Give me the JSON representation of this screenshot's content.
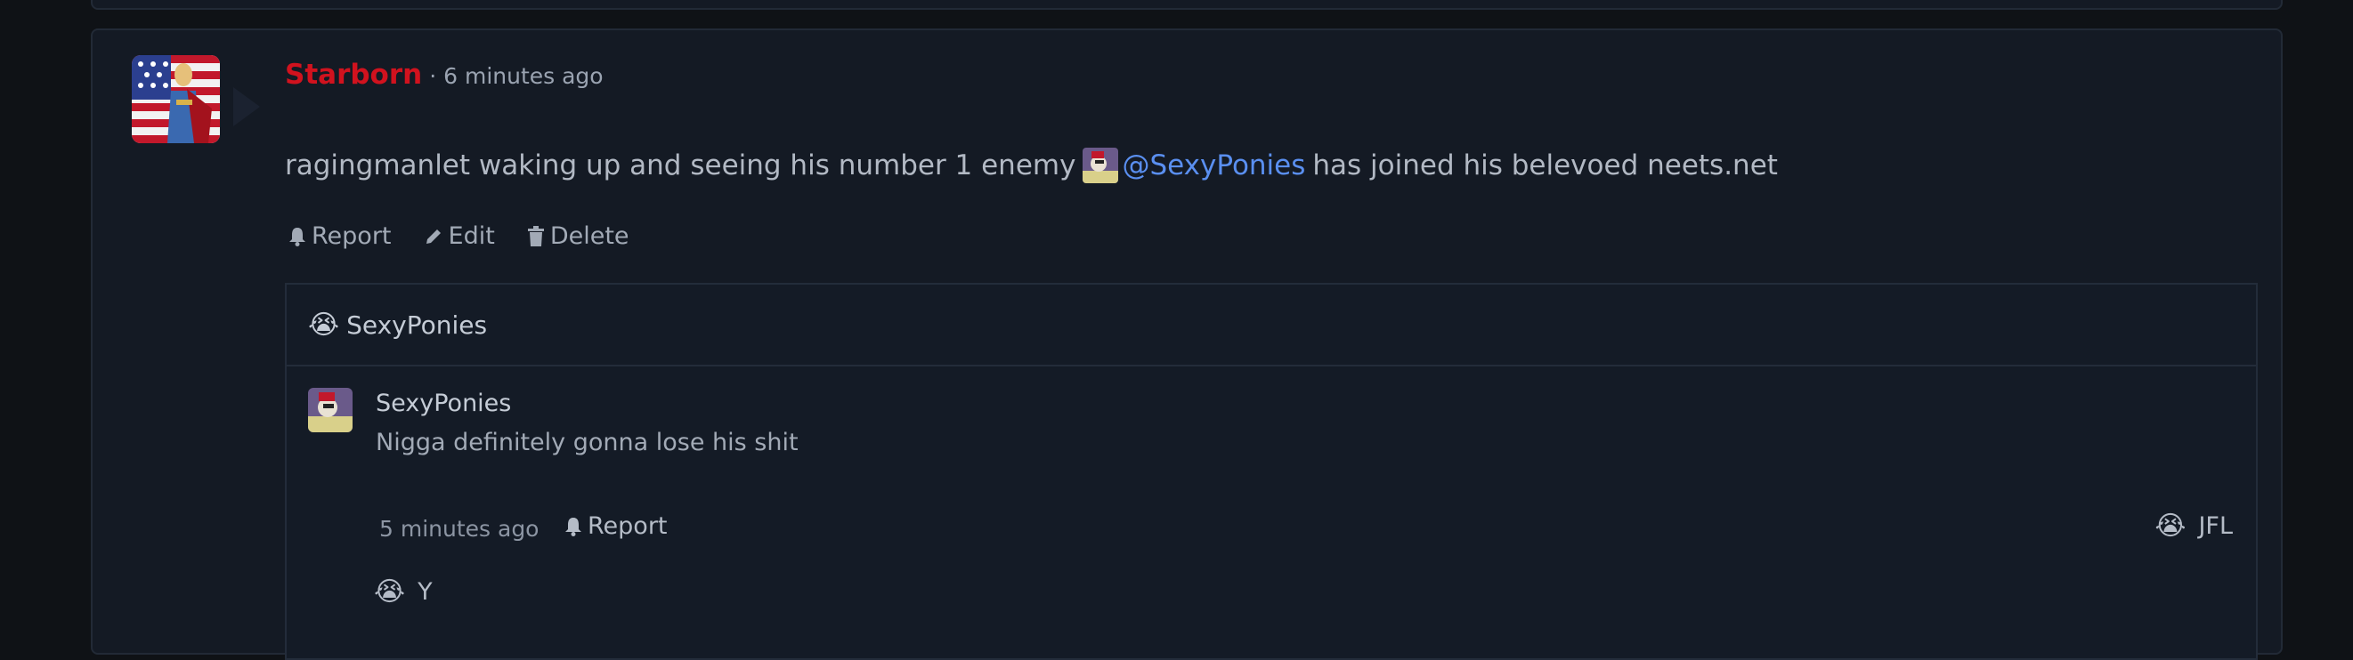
{
  "post": {
    "author": "Starborn",
    "separator": "·",
    "time": "6 minutes ago",
    "text_before": "ragingmanlet waking up and seeing his number 1 enemy",
    "mention": "@SexyPonies",
    "text_after": "has joined his belevoed neets.net",
    "actions": {
      "report": "Report",
      "edit": "Edit",
      "delete": "Delete"
    }
  },
  "comments": {
    "header_emoji": "😭",
    "header_user": "SexyPonies",
    "item": {
      "user": "SexyPonies",
      "text": "Nigga definitely gonna lose his shit",
      "time": "5 minutes ago",
      "report": "Report",
      "reaction_emoji": "😭",
      "reaction_label": "JFL"
    },
    "next_emoji": "😭",
    "next_partial": "Y"
  },
  "colors": {
    "author": "#d1121e",
    "mention": "#5a8ff0",
    "background": "#0f1216",
    "card": "#141a24"
  }
}
